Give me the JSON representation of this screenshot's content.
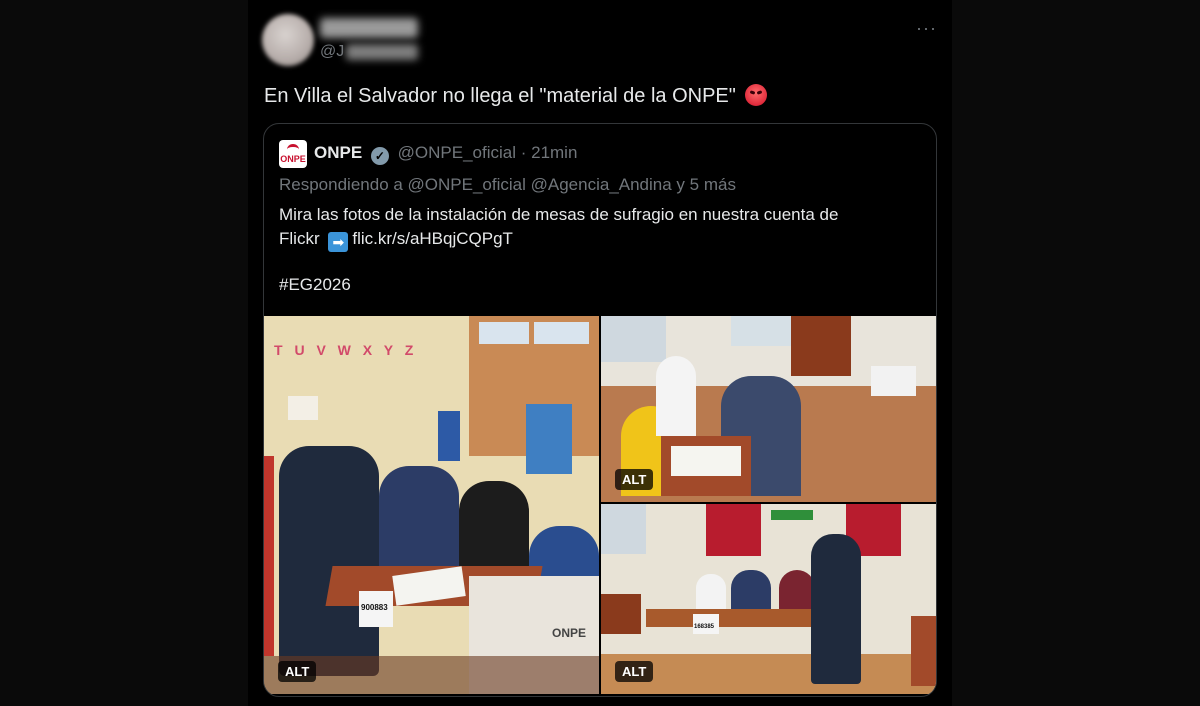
{
  "tweet": {
    "handle_prefix": "@J",
    "more": "···",
    "text": "En Villa el Salvador no llega el \"material de la ONPE\""
  },
  "quote": {
    "logo_text": "ONPE",
    "name": "ONPE",
    "verified": "✓",
    "handle_time": "@ONPE_oficial · 21min",
    "reply_line": "Respondiendo a @ONPE_oficial @Agencia_Andina y 5 más",
    "body_line1": "Mira las fotos de la instalación de mesas de sufragio en nuestra cuenta de",
    "body_line2_start": "Flickr",
    "arrow": "➡",
    "link": "flic.kr/s/aHBqjCQPgT",
    "hashtag": "#EG2026"
  },
  "photos": {
    "alt_label": "ALT",
    "p1_wall_letters": "T U V W X Y Z",
    "p1_table_number": "900883",
    "p1_box_label": "ONPE",
    "p3_table_number": "168385"
  },
  "colors": {
    "background": "#000000",
    "muted_text": "#71767b",
    "border": "#333639",
    "onpe_red": "#c8102e"
  }
}
